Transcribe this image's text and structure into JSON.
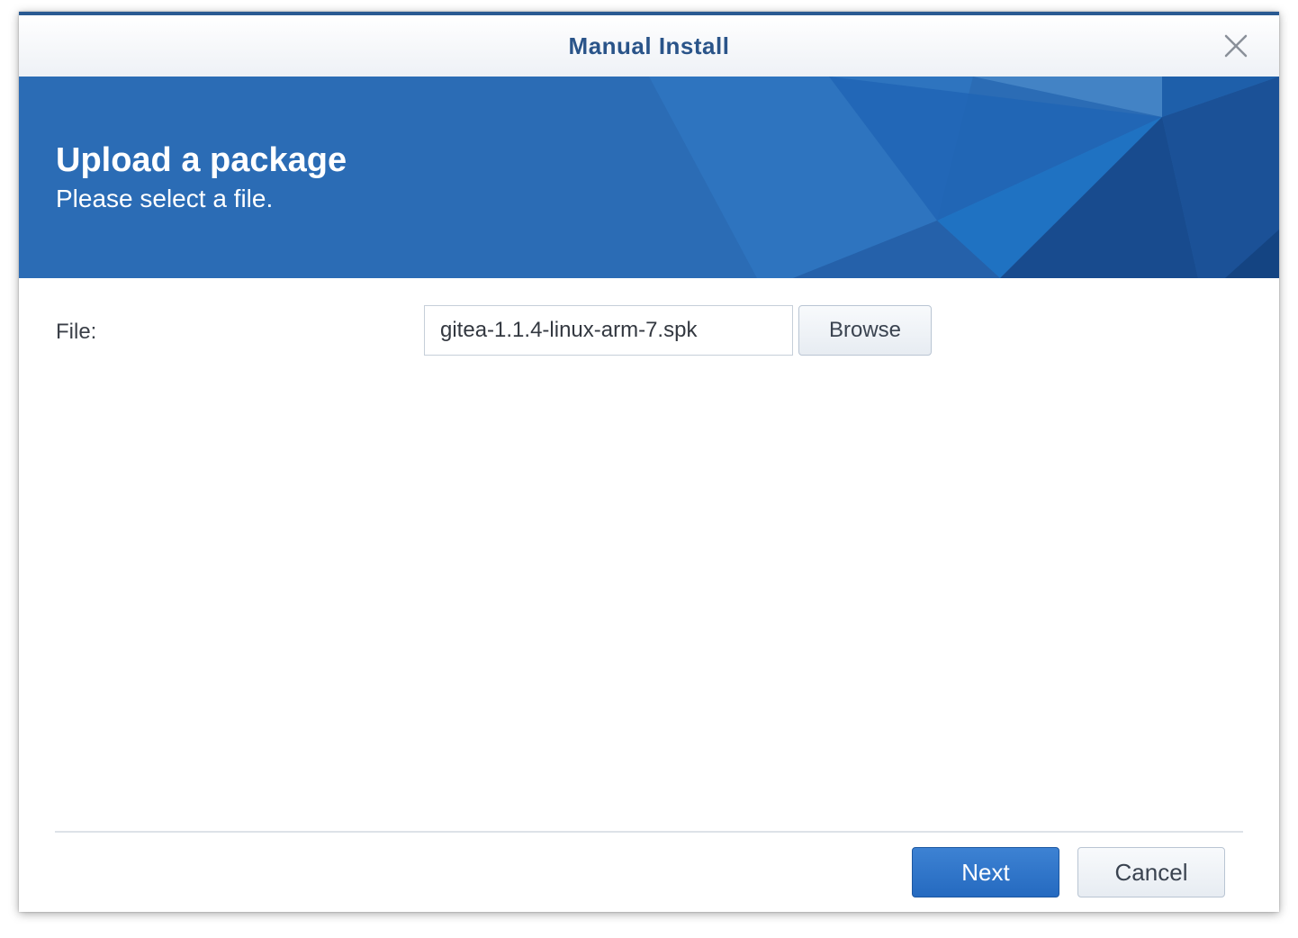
{
  "window": {
    "title": "Manual Install"
  },
  "banner": {
    "title": "Upload a package",
    "subtitle": "Please select a file."
  },
  "form": {
    "file_label": "File:",
    "file_value": "gitea-1.1.4-linux-arm-7.spk",
    "browse_label": "Browse"
  },
  "footer": {
    "next_label": "Next",
    "cancel_label": "Cancel"
  },
  "colors": {
    "title_text": "#2a5489",
    "banner_base": "#2b6cb5",
    "primary_button": "#256ac0"
  },
  "icons": {
    "close": "close-icon"
  }
}
